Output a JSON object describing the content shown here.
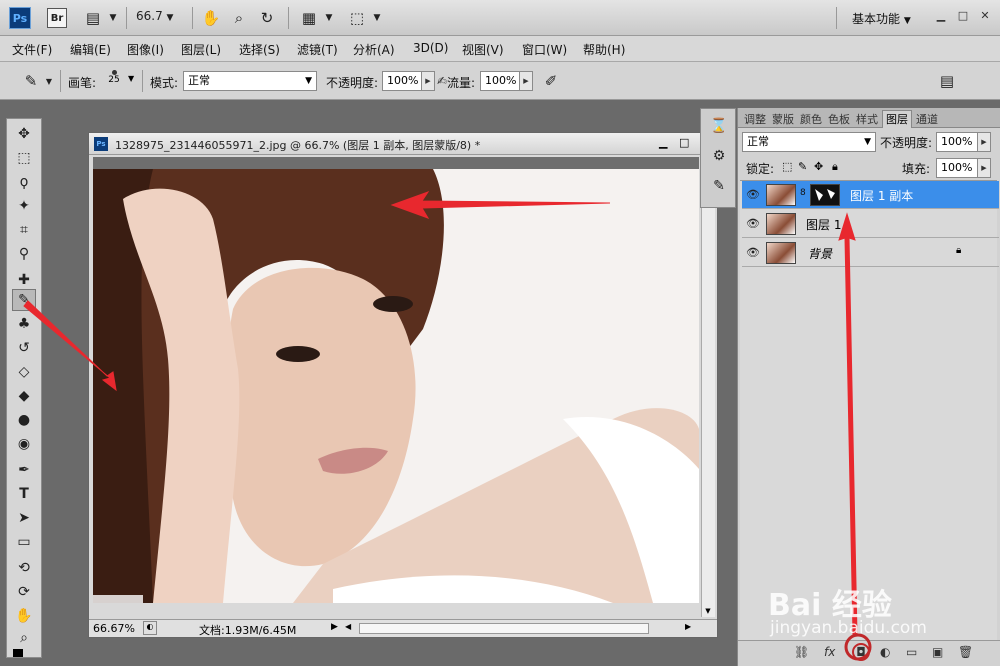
{
  "appbar": {
    "ps_logo": "Ps",
    "br_logo": "Br",
    "zoom": "66.7",
    "workspace": "基本功能"
  },
  "menu": [
    "文件(F)",
    "编辑(E)",
    "图像(I)",
    "图层(L)",
    "选择(S)",
    "滤镜(T)",
    "分析(A)",
    "3D(D)",
    "视图(V)",
    "窗口(W)",
    "帮助(H)"
  ],
  "options": {
    "brush_label": "画笔:",
    "brush_size": "25",
    "mode_label": "模式:",
    "mode_value": "正常",
    "opacity_label": "不透明度:",
    "opacity_value": "100%",
    "flow_label": "流量:",
    "flow_value": "100%"
  },
  "document": {
    "title": "1328975_231446055971_2.jpg @ 66.7% (图层 1 副本, 图层蒙版/8) *",
    "zoom": "66.67%",
    "doc_info": "文档:1.93M/6.45M"
  },
  "panels": {
    "tabs": [
      "调整",
      "蒙版",
      "颜色",
      "色板",
      "样式",
      "图层",
      "通道"
    ],
    "blend_mode": "正常",
    "opacity_label": "不透明度:",
    "opacity_value": "100%",
    "lock_label": "锁定:",
    "fill_label": "填充:",
    "fill_value": "100%",
    "layers": [
      {
        "name": "图层 1 副本",
        "selected": true
      },
      {
        "name": "图层 1",
        "selected": false
      },
      {
        "name": "背景",
        "selected": false
      }
    ]
  },
  "watermark": {
    "brand": "Bai 经验",
    "url": "jingyan.baidu.com"
  }
}
